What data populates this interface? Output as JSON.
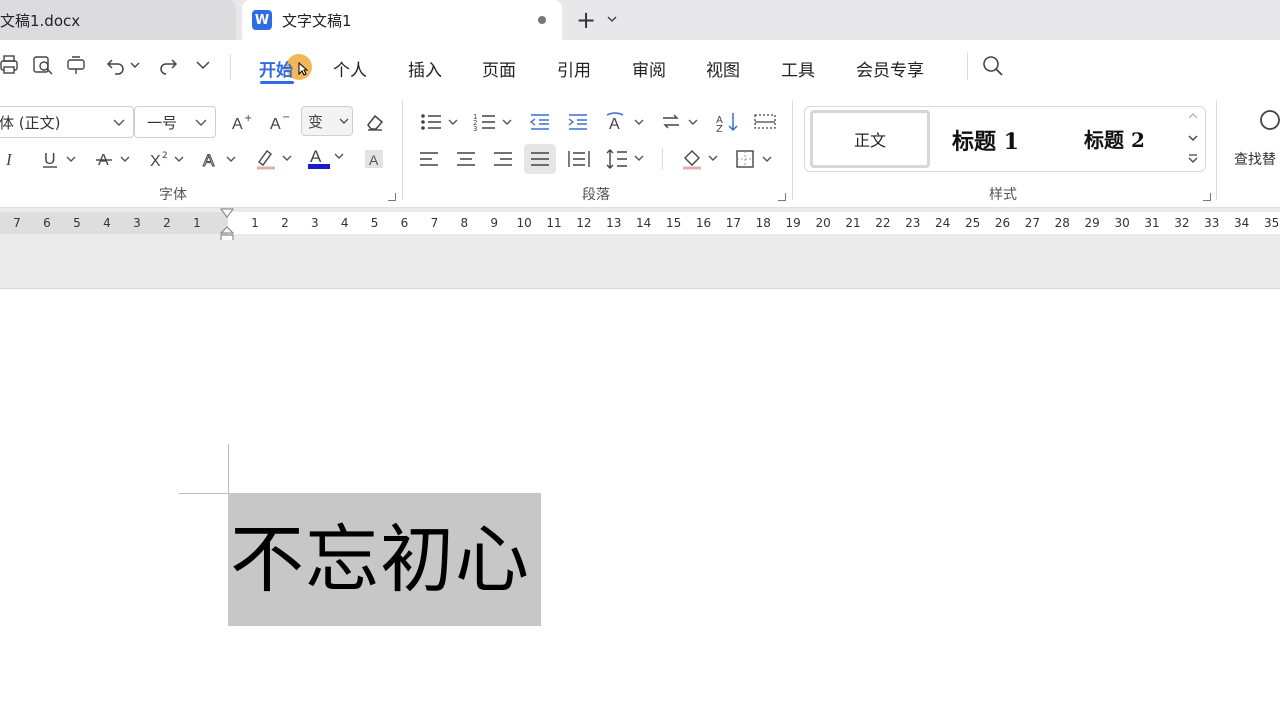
{
  "tabs": [
    {
      "label": "文稿1.docx"
    },
    {
      "label": "文字文稿1"
    }
  ],
  "menu": {
    "items": [
      "开始",
      "个人",
      "插入",
      "页面",
      "引用",
      "审阅",
      "视图",
      "工具",
      "会员专享"
    ]
  },
  "ribbon": {
    "font_name": "体 (正文)",
    "font_size": "一号",
    "group_font": "字体",
    "group_paragraph": "段落",
    "group_styles": "样式",
    "style_normal": "正文",
    "style_h1": "标题 1",
    "style_h2": "标题 2",
    "find_replace": "查找替"
  },
  "ruler": {
    "left": [
      "7",
      "6",
      "5",
      "4",
      "3",
      "2",
      "1"
    ],
    "right": [
      "1",
      "2",
      "3",
      "4",
      "5",
      "6",
      "7",
      "8",
      "9",
      "10",
      "11",
      "12",
      "13",
      "14",
      "15",
      "16",
      "17",
      "18",
      "19",
      "20",
      "21",
      "22",
      "23",
      "24",
      "25",
      "26",
      "27",
      "28",
      "29",
      "30",
      "31",
      "32",
      "33",
      "34",
      "35"
    ]
  },
  "document": {
    "text": "不忘初心"
  },
  "colors": {
    "accent": "#2f6be6",
    "font_color": "#1a1acc",
    "selection": "#c7c7c7"
  }
}
